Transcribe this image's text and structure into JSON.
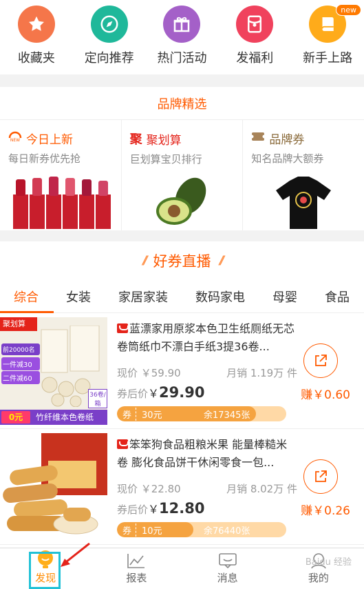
{
  "quicknav": [
    {
      "label": "收藏夹",
      "icon": "star-icon",
      "color": "#f5764a"
    },
    {
      "label": "定向推荐",
      "icon": "compass-icon",
      "color": "#1fb89a"
    },
    {
      "label": "热门活动",
      "icon": "gift-icon",
      "color": "#a460c8"
    },
    {
      "label": "发福利",
      "icon": "red-envelope-icon",
      "color": "#f0425d"
    },
    {
      "label": "新手上路",
      "icon": "book-icon",
      "color": "#ffab1a",
      "badge": "new"
    }
  ],
  "brand": {
    "title": "品牌精选",
    "cols": [
      {
        "title": "今日上新",
        "sub": "每日新券优先抢",
        "icon": "new-tag-icon",
        "title_color": "#ff5a00"
      },
      {
        "title": "聚划算",
        "sub": "巨划算宝贝排行",
        "icon": "ju-logo-icon",
        "title_color": "#e4231a"
      },
      {
        "title": "品牌券",
        "sub": "知名品牌大额券",
        "icon": "ticket-icon",
        "title_color": "#8a6a3a"
      }
    ]
  },
  "live": {
    "title": "好券直播",
    "tabs": [
      "综合",
      "女装",
      "家居家装",
      "数码家电",
      "母婴",
      "食品"
    ],
    "products": [
      {
        "title": "蓝漂家用原浆本色卫生纸厕纸无芯卷筒纸巾不漂白手纸3提36卷...",
        "price_label": "现价 ￥59.90",
        "sales_label": "月销 1.19万 件",
        "after_label": "券后价",
        "after_cur": "￥",
        "after_price": "29.90",
        "coupon_tag": "券",
        "coupon_amount": "30元",
        "coupon_rest": "余17345张",
        "coupon_remaining_fraction": 0.82,
        "earn": "赚￥0.60",
        "img_text_top": "聚划算",
        "img_text_mid": "前20000名",
        "img_text_a": "一件减30",
        "img_text_b": "二件减60",
        "img_text_bottom": "竹纤维本色卷纸",
        "img_badge": "36卷/箱",
        "img_coupon": "0元"
      },
      {
        "title": "笨笨狗食品粗粮米果 能量棒糙米卷 膨化食品饼干休闲零食一包...",
        "price_label": "现价 ￥22.80",
        "sales_label": "月销 8.02万 件",
        "after_label": "券后价",
        "after_cur": "￥",
        "after_price": "12.80",
        "coupon_tag": "券",
        "coupon_amount": "10元",
        "coupon_rest": "余76440张",
        "coupon_remaining_fraction": 0.45,
        "earn": "赚￥0.26"
      }
    ]
  },
  "bottomnav": [
    {
      "label": "发现",
      "icon": "bulb-icon",
      "active": true
    },
    {
      "label": "报表",
      "icon": "chart-icon",
      "active": false
    },
    {
      "label": "消息",
      "icon": "message-icon",
      "active": false
    },
    {
      "label": "我的",
      "icon": "user-icon",
      "active": false
    }
  ],
  "watermark": "Baidu 经验"
}
